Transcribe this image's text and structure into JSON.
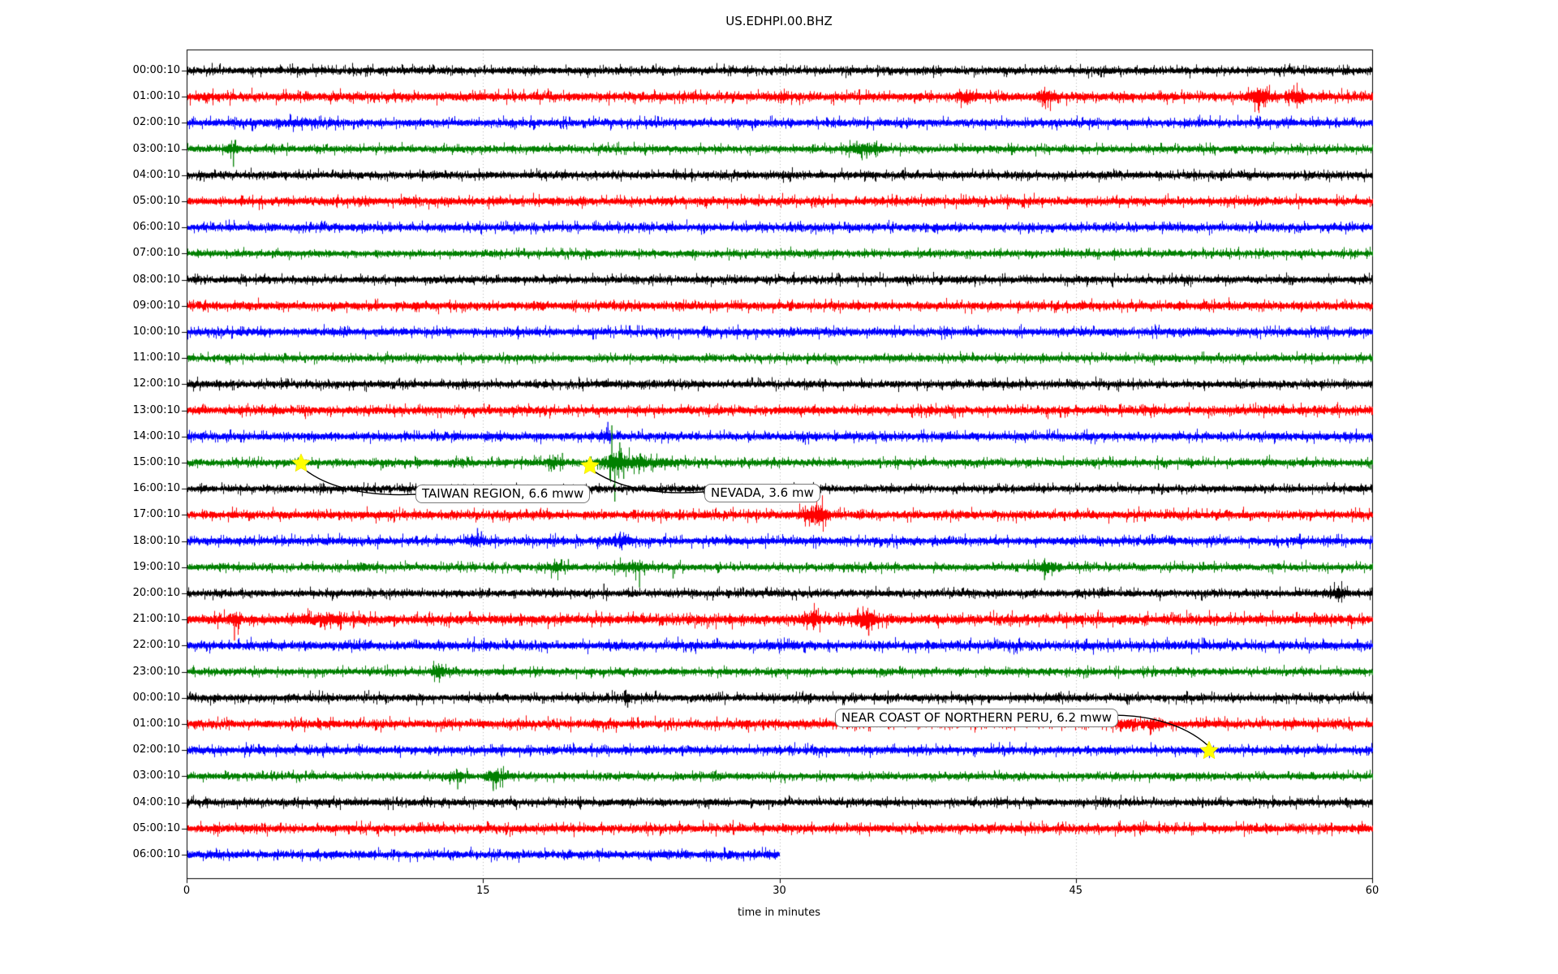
{
  "title": "US.EDHPI.00.BHZ",
  "x_axis": {
    "label": "time in minutes",
    "ticks": [
      {
        "label": "0",
        "minute": 0
      },
      {
        "label": "15",
        "minute": 15
      },
      {
        "label": "30",
        "minute": 30
      },
      {
        "label": "45",
        "minute": 45
      },
      {
        "label": "60",
        "minute": 60
      }
    ]
  },
  "chart_data": {
    "type": "line",
    "subtype": "seismogram-dayplot",
    "title": "US.EDHPI.00.BHZ",
    "xlabel": "time in minutes",
    "x_range_minutes": [
      0,
      60
    ],
    "grid_minutes": [
      15,
      30,
      45
    ],
    "grid_color": "#b4b4b4",
    "color_cycle": [
      "#000000",
      "#ff0000",
      "#0000ff",
      "#008000"
    ],
    "marker_color": "#ffff00",
    "traces": [
      {
        "label": "00:00:10",
        "color": "#000000",
        "amp": 3.6,
        "end": 60,
        "features": []
      },
      {
        "label": "01:00:10",
        "color": "#ff0000",
        "amp": 4.2,
        "end": 60,
        "features": [
          {
            "t": 39.5,
            "type": "burst",
            "w": 0.4,
            "m": 2.2
          },
          {
            "t": 39.5,
            "type": "down",
            "a": 10
          },
          {
            "t": 43.5,
            "type": "burst",
            "w": 0.4,
            "m": 2.0
          },
          {
            "t": 54.3,
            "type": "burst",
            "w": 0.5,
            "m": 2.6
          },
          {
            "t": 56.2,
            "type": "burst",
            "w": 0.4,
            "m": 2.3
          }
        ]
      },
      {
        "label": "02:00:10",
        "color": "#0000ff",
        "amp": 3.8,
        "end": 60,
        "features": [
          {
            "t": 5.5,
            "type": "burst",
            "w": 2.0,
            "m": 1.3
          }
        ]
      },
      {
        "label": "03:00:10",
        "color": "#008000",
        "amp": 3.4,
        "end": 60,
        "features": [
          {
            "t": 2.35,
            "type": "down",
            "a": 22
          },
          {
            "t": 2.3,
            "type": "burst",
            "w": 0.3,
            "m": 2.0
          },
          {
            "t": 34.2,
            "type": "burst",
            "w": 0.8,
            "m": 2.2
          },
          {
            "t": 33.9,
            "type": "up",
            "a": 10
          },
          {
            "t": 34.4,
            "type": "down",
            "a": 12
          }
        ]
      },
      {
        "label": "04:00:10",
        "color": "#000000",
        "amp": 3.6,
        "end": 60,
        "features": []
      },
      {
        "label": "05:00:10",
        "color": "#ff0000",
        "amp": 4.0,
        "end": 60,
        "features": []
      },
      {
        "label": "06:00:10",
        "color": "#0000ff",
        "amp": 3.8,
        "end": 60,
        "features": []
      },
      {
        "label": "07:00:10",
        "color": "#008000",
        "amp": 3.4,
        "end": 60,
        "features": []
      },
      {
        "label": "08:00:10",
        "color": "#000000",
        "amp": 3.6,
        "end": 60,
        "features": []
      },
      {
        "label": "09:00:10",
        "color": "#ff0000",
        "amp": 4.0,
        "end": 60,
        "features": []
      },
      {
        "label": "10:00:10",
        "color": "#0000ff",
        "amp": 3.8,
        "end": 60,
        "features": [
          {
            "t": 2.8,
            "type": "up",
            "a": 7
          }
        ]
      },
      {
        "label": "11:00:10",
        "color": "#008000",
        "amp": 3.4,
        "end": 60,
        "features": [
          {
            "t": 0.7,
            "type": "up",
            "a": 6
          }
        ]
      },
      {
        "label": "12:00:10",
        "color": "#000000",
        "amp": 3.6,
        "end": 60,
        "features": []
      },
      {
        "label": "13:00:10",
        "color": "#ff0000",
        "amp": 4.0,
        "end": 60,
        "features": []
      },
      {
        "label": "14:00:10",
        "color": "#0000ff",
        "amp": 3.8,
        "end": 60,
        "features": [
          {
            "t": 21.3,
            "type": "up",
            "a": 18
          },
          {
            "t": 21.4,
            "type": "down",
            "a": 9
          },
          {
            "t": 21.3,
            "type": "burst",
            "w": 0.3,
            "m": 1.6
          }
        ]
      },
      {
        "label": "15:00:10",
        "color": "#008000",
        "amp": 3.6,
        "end": 60,
        "features": [
          {
            "t": 18.6,
            "type": "burst",
            "w": 0.3,
            "m": 2.0
          },
          {
            "t": 19.0,
            "type": "up",
            "a": 12
          },
          {
            "t": 21.8,
            "type": "burst",
            "w": 0.7,
            "m": 3.2
          },
          {
            "t": 21.5,
            "type": "up",
            "a": 46
          },
          {
            "t": 21.65,
            "type": "down",
            "a": 48
          },
          {
            "t": 21.9,
            "type": "up",
            "a": 25
          },
          {
            "t": 22.1,
            "type": "down",
            "a": 20
          },
          {
            "t": 23.5,
            "type": "burst",
            "w": 1.3,
            "m": 1.8
          }
        ]
      },
      {
        "label": "16:00:10",
        "color": "#000000",
        "amp": 3.4,
        "end": 60,
        "features": []
      },
      {
        "label": "17:00:10",
        "color": "#ff0000",
        "amp": 4.0,
        "end": 60,
        "features": [
          {
            "t": 31.8,
            "type": "burst",
            "w": 0.6,
            "m": 2.8
          },
          {
            "t": 31.9,
            "type": "down",
            "a": 10
          },
          {
            "t": 31.6,
            "type": "up",
            "a": 8
          }
        ]
      },
      {
        "label": "18:00:10",
        "color": "#0000ff",
        "amp": 3.8,
        "end": 60,
        "features": [
          {
            "t": 14.7,
            "type": "burst",
            "w": 0.3,
            "m": 2.2
          },
          {
            "t": 14.7,
            "type": "up",
            "a": 16
          },
          {
            "t": 14.9,
            "type": "up",
            "a": 12
          },
          {
            "t": 21.9,
            "type": "burst",
            "w": 0.5,
            "m": 2.0
          },
          {
            "t": 21.9,
            "type": "up",
            "a": 8
          }
        ]
      },
      {
        "label": "19:00:10",
        "color": "#008000",
        "amp": 3.4,
        "end": 60,
        "features": [
          {
            "t": 8.8,
            "type": "burst",
            "w": 0.5,
            "m": 1.5
          },
          {
            "t": 18.7,
            "type": "burst",
            "w": 0.4,
            "m": 2.0
          },
          {
            "t": 19.3,
            "type": "up",
            "a": 10
          },
          {
            "t": 22.5,
            "type": "burst",
            "w": 0.8,
            "m": 2.0
          },
          {
            "t": 22.9,
            "type": "down",
            "a": 25
          },
          {
            "t": 24.6,
            "type": "down",
            "a": 14
          },
          {
            "t": 43.5,
            "type": "burst",
            "w": 0.5,
            "m": 2.0
          },
          {
            "t": 43.4,
            "type": "down",
            "a": 16
          },
          {
            "t": 47.7,
            "type": "up",
            "a": 6
          }
        ]
      },
      {
        "label": "20:00:10",
        "color": "#000000",
        "amp": 3.6,
        "end": 60,
        "features": [
          {
            "t": 21.1,
            "type": "up",
            "a": 12
          },
          {
            "t": 58.2,
            "type": "burst",
            "w": 0.4,
            "m": 2.2
          }
        ]
      },
      {
        "label": "21:00:10",
        "color": "#ff0000",
        "amp": 4.6,
        "end": 60,
        "features": [
          {
            "t": 2.4,
            "type": "down",
            "a": 26
          },
          {
            "t": 2.4,
            "type": "burst",
            "w": 0.3,
            "m": 2.2
          },
          {
            "t": 7.0,
            "type": "burst",
            "w": 1.5,
            "m": 1.5
          },
          {
            "t": 8.4,
            "type": "up",
            "a": 10
          },
          {
            "t": 31.6,
            "type": "burst",
            "w": 0.4,
            "m": 2.0
          },
          {
            "t": 34.3,
            "type": "burst",
            "w": 0.5,
            "m": 2.4
          },
          {
            "t": 34.5,
            "type": "down",
            "a": 20
          },
          {
            "t": 34.2,
            "type": "up",
            "a": 8
          }
        ]
      },
      {
        "label": "22:00:10",
        "color": "#0000ff",
        "amp": 4.2,
        "end": 60,
        "features": []
      },
      {
        "label": "23:00:10",
        "color": "#008000",
        "amp": 3.4,
        "end": 60,
        "features": [
          {
            "t": 12.7,
            "type": "burst",
            "w": 0.4,
            "m": 2.4
          },
          {
            "t": 12.6,
            "type": "up",
            "a": 8
          }
        ]
      },
      {
        "label": "00:00:10",
        "color": "#000000",
        "amp": 3.6,
        "end": 60,
        "features": [
          {
            "t": 22.3,
            "type": "down",
            "a": 12
          },
          {
            "t": 22.3,
            "type": "burst",
            "w": 0.3,
            "m": 1.6
          }
        ]
      },
      {
        "label": "01:00:10",
        "color": "#ff0000",
        "amp": 4.0,
        "end": 60,
        "features": [
          {
            "t": 47.5,
            "type": "burst",
            "w": 0.8,
            "m": 1.6
          },
          {
            "t": 49.0,
            "type": "burst",
            "w": 0.4,
            "m": 1.7
          }
        ]
      },
      {
        "label": "02:00:10",
        "color": "#0000ff",
        "amp": 3.8,
        "end": 60,
        "features": []
      },
      {
        "label": "03:00:10",
        "color": "#008000",
        "amp": 3.4,
        "end": 60,
        "features": [
          {
            "t": 13.6,
            "type": "burst",
            "w": 0.4,
            "m": 2.0
          },
          {
            "t": 13.7,
            "type": "down",
            "a": 16
          },
          {
            "t": 15.6,
            "type": "burst",
            "w": 0.5,
            "m": 2.2
          },
          {
            "t": 15.5,
            "type": "down",
            "a": 18
          },
          {
            "t": 15.9,
            "type": "up",
            "a": 10
          }
        ]
      },
      {
        "label": "04:00:10",
        "color": "#000000",
        "amp": 3.6,
        "end": 60,
        "features": []
      },
      {
        "label": "05:00:10",
        "color": "#ff0000",
        "amp": 4.0,
        "end": 60,
        "features": []
      },
      {
        "label": "06:00:10",
        "color": "#0000ff",
        "amp": 3.8,
        "end": 30,
        "features": []
      }
    ],
    "events": [
      {
        "label": "TAIWAN REGION, 6.6 mww",
        "trace_label": "15:00:10",
        "trace_index": 15,
        "minute": 5.8
      },
      {
        "label": "NEVADA, 3.6 mw",
        "trace_label": "15:00:10",
        "trace_index": 15,
        "minute": 20.4
      },
      {
        "label": "NEAR COAST OF NORTHERN PERU, 6.2 mww",
        "trace_label": "02:00:10",
        "trace_index": 26,
        "minute": 51.7
      }
    ]
  }
}
